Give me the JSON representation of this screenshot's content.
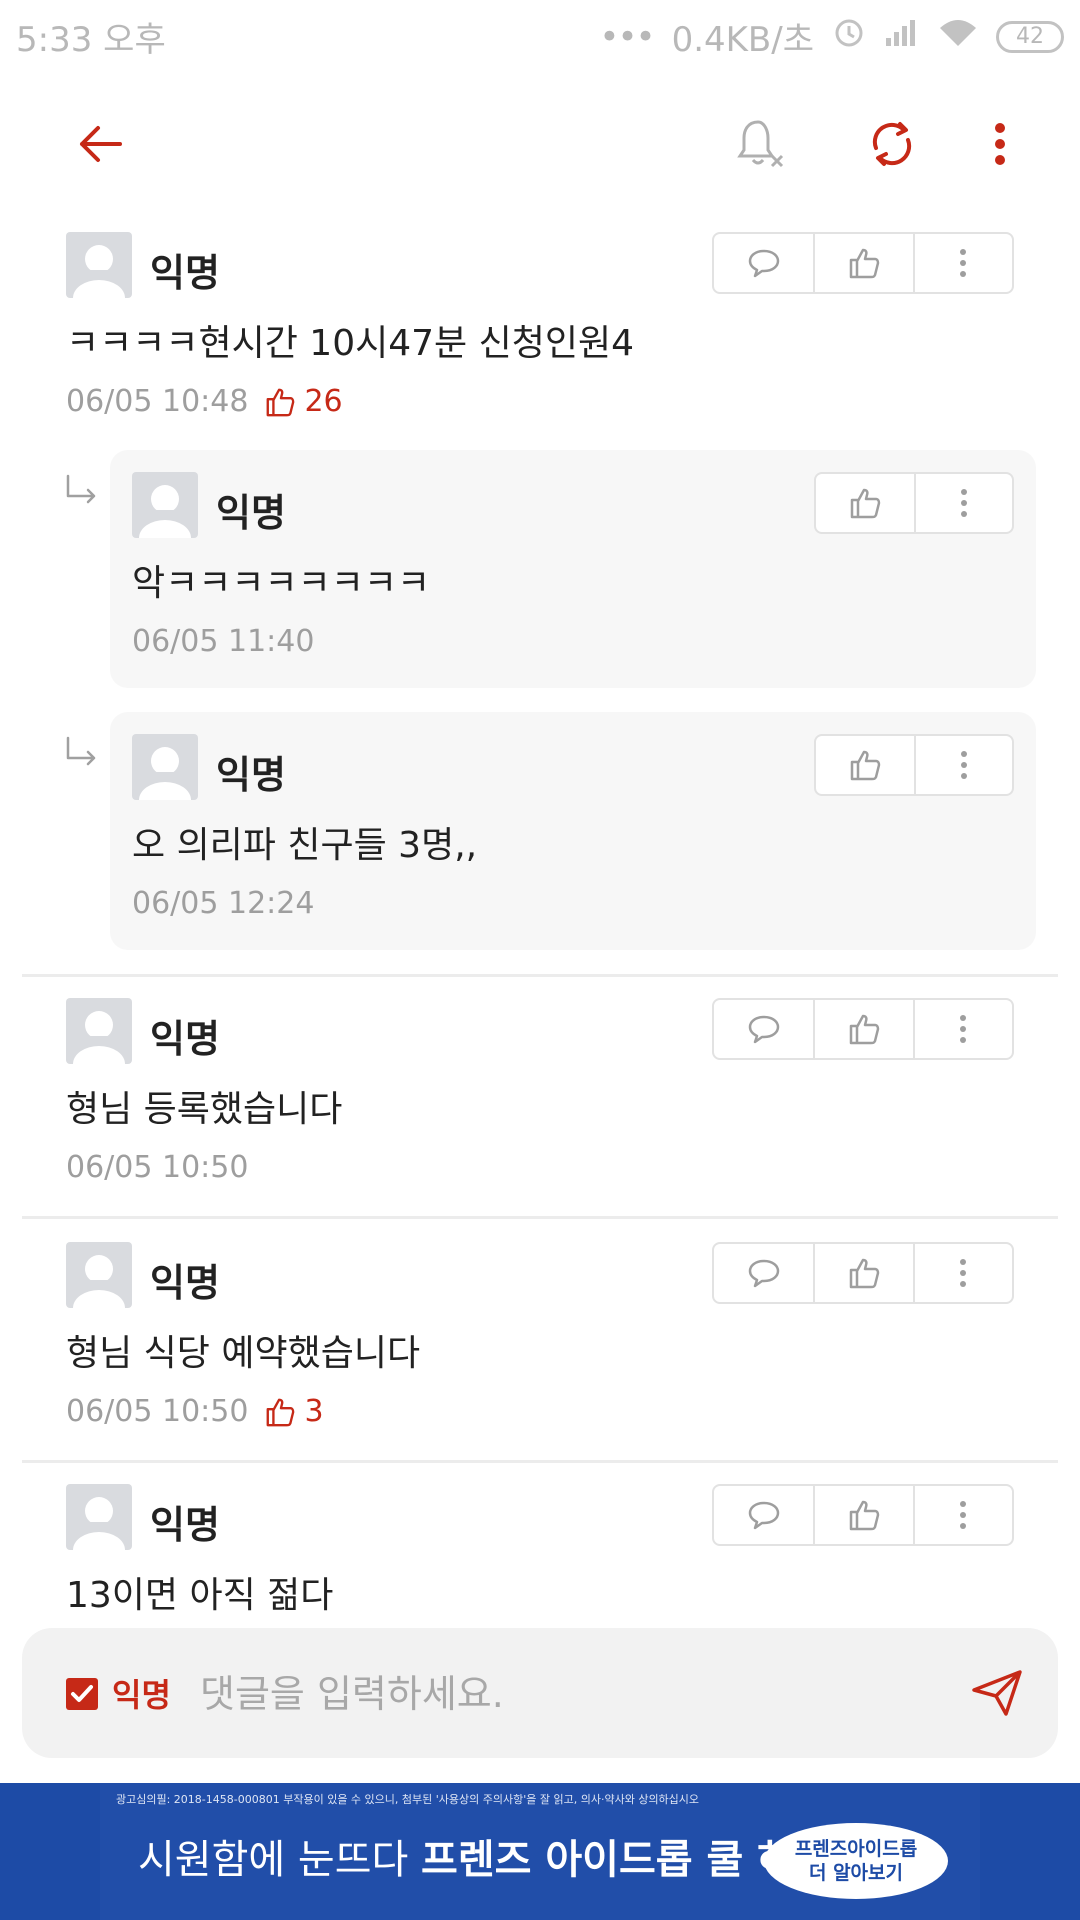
{
  "status_bar": {
    "time": "5:33 오후",
    "net_speed": "0.4KB/초",
    "battery": "42"
  },
  "toolbar": {
    "back_icon": "arrow-left-icon",
    "notify_icon": "bell-off-icon",
    "refresh_icon": "refresh-icon",
    "more_icon": "more-vertical-icon"
  },
  "accent_color": "#c62917",
  "comments": [
    {
      "author": "익명",
      "text": "ㅋㅋㅋㅋ현시간 10시47분 신청인원4",
      "time": "06/05 10:48",
      "likes": "26"
    },
    {
      "author": "익명",
      "text": "악ㅋㅋㅋㅋㅋㅋㅋㅋ",
      "time": "06/05 11:40",
      "reply": true
    },
    {
      "author": "익명",
      "text": "오 의리파 친구들 3명,,",
      "time": "06/05 12:24",
      "reply": true
    },
    {
      "author": "익명",
      "text": "형님 등록했습니다",
      "time": "06/05 10:50"
    },
    {
      "author": "익명",
      "text": "형님 식당 예약했습니다",
      "time": "06/05 10:50",
      "likes": "3"
    },
    {
      "author": "익명",
      "text": "13이면 아직 젊다"
    }
  ],
  "input": {
    "anonymous_label": "익명",
    "anonymous_checked": true,
    "placeholder": "댓글을 입력하세요."
  },
  "ad": {
    "disclaimer": "광고심의필: 2018-1458-000801 부작용이 있을 수 있으니, 첨부된 '사용상의 주의사항'을 잘 읽고, 의사·약사와 상의하십시오",
    "headline_prefix": "시원함에 눈뜨다",
    "headline_brand": "프렌즈 아이드롭 쿨 하이",
    "badge_line1": "프렌즈아이드롭",
    "badge_line2": "더 알아보기"
  }
}
